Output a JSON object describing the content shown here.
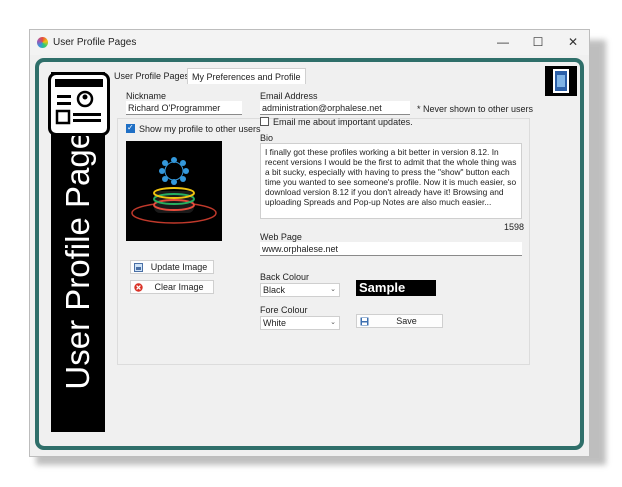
{
  "window": {
    "title": "User Profile Pages"
  },
  "banner": {
    "text": "User Profile Pages"
  },
  "tabs": [
    {
      "label": "User Profile Pages"
    },
    {
      "label": "My Preferences and Profile"
    }
  ],
  "profile": {
    "nickname_label": "Nickname",
    "nickname_value": "Richard O'Programmer",
    "email_label": "Email Address",
    "email_value": "administration@orphalese.net",
    "email_note": "* Never shown to other users",
    "email_updates_label": "Email me about important updates.",
    "email_updates_checked": false,
    "show_profile_label": "Show my profile to other users",
    "show_profile_checked": true,
    "update_image_label": "Update Image",
    "clear_image_label": "Clear Image",
    "bio_label": "Bio",
    "bio_text": "I finally got these profiles working a bit better in version 8.12. In recent versions I would be the first to admit that the whole thing was a bit sucky, especially with having to press the \"show\" button each time you wanted to see someone's profile. Now it is much easier, so download version 8.12 if you don't already have it! Browsing and uploading Spreads and Pop-up Notes are also much easier...",
    "bio_count": "1598",
    "webpage_label": "Web Page",
    "webpage_value": "www.orphalese.net",
    "back_colour_label": "Back Colour",
    "back_colour_value": "Black",
    "fore_colour_label": "Fore Colour",
    "fore_colour_value": "White",
    "sample_label": "Sample",
    "save_label": "Save"
  },
  "colors": {
    "frame": "#2f6f6a",
    "check_accent": "#1f6fc5",
    "sample_bg": "#000000",
    "sample_fg": "#ffffff"
  }
}
